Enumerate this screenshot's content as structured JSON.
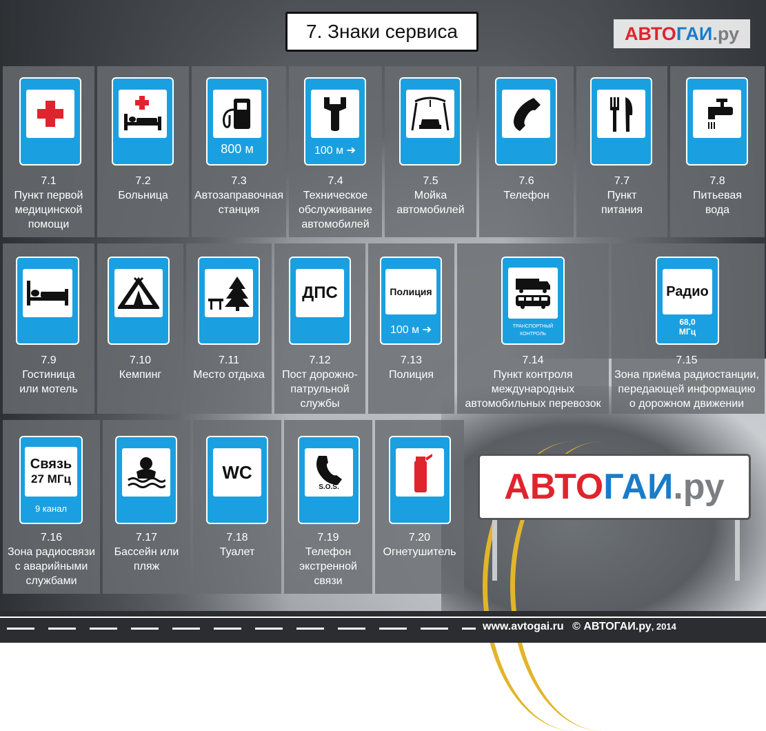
{
  "title": "7. Знаки сервиса",
  "brand": {
    "part1": "АВТО",
    "part2": "ГАИ",
    "part3": ".ру"
  },
  "big_brand": {
    "part1": "АВТО",
    "part2": "ГАИ",
    "part3": ".ру"
  },
  "footer": {
    "site": "www.avtogai.ru",
    "copyright": "© АВТОГАИ.ру",
    "year": ", 2014"
  },
  "colors": {
    "sign_blue": "#1aa0e0",
    "red": "#e0242e",
    "brand_blue": "#1a7cc9"
  },
  "signs": [
    {
      "num": "7.1",
      "lines": [
        "Пункт первой",
        "медицинской",
        "помощи"
      ],
      "icon": "first-aid-cross-icon"
    },
    {
      "num": "7.2",
      "lines": [
        "Больница"
      ],
      "icon": "hospital-bed-icon"
    },
    {
      "num": "7.3",
      "lines": [
        "Автозаправочная",
        "станция"
      ],
      "icon": "fuel-pump-icon",
      "sub": "800 м"
    },
    {
      "num": "7.4",
      "lines": [
        "Техническое",
        "обслуживание",
        "автомобилей"
      ],
      "icon": "wrench-icon",
      "sub": "100 м"
    },
    {
      "num": "7.5",
      "lines": [
        "Мойка",
        "автомобилей"
      ],
      "icon": "car-wash-icon"
    },
    {
      "num": "7.6",
      "lines": [
        "Телефон"
      ],
      "icon": "telephone-icon"
    },
    {
      "num": "7.7",
      "lines": [
        "Пункт",
        "питания"
      ],
      "icon": "fork-knife-icon"
    },
    {
      "num": "7.8",
      "lines": [
        "Питьевая",
        "вода"
      ],
      "icon": "water-tap-icon"
    },
    {
      "num": "7.9",
      "lines": [
        "Гостиница",
        "или мотель"
      ],
      "icon": "bed-icon"
    },
    {
      "num": "7.10",
      "lines": [
        "Кемпинг"
      ],
      "icon": "tent-icon"
    },
    {
      "num": "7.11",
      "lines": [
        "Место отдыха"
      ],
      "icon": "tree-bench-icon"
    },
    {
      "num": "7.12",
      "lines": [
        "Пост дорожно-",
        "патрульной",
        "службы"
      ],
      "icon": "dps-icon",
      "text": "ДПС"
    },
    {
      "num": "7.13",
      "lines": [
        "Полиция"
      ],
      "icon": "police-icon",
      "text": "Полиция",
      "sub": "100 м"
    },
    {
      "num": "7.14",
      "lines": [
        "Пункт контроля",
        "международных",
        "автомобильных перевозок"
      ],
      "icon": "truck-bus-icon",
      "text": "ТРАНСПОРТНЫЙ КОНТРОЛЬ"
    },
    {
      "num": "7.15",
      "lines": [
        "Зона приёма радиостанции,",
        "передающей информацию",
        "о дорожном движении"
      ],
      "icon": "radio-icon",
      "text": "Радио",
      "sub1": "68,0",
      "sub2": "МГц"
    },
    {
      "num": "7.16",
      "lines": [
        "Зона радиосвязи",
        "с аварийными",
        "службами"
      ],
      "icon": "radio-link-icon",
      "text1": "Связь",
      "text2": "27 МГц",
      "sub": "9 канал"
    },
    {
      "num": "7.17",
      "lines": [
        "Бассейн или",
        "пляж"
      ],
      "icon": "swimmer-icon"
    },
    {
      "num": "7.18",
      "lines": [
        "Туалет"
      ],
      "icon": "wc-icon",
      "text": "WC"
    },
    {
      "num": "7.19",
      "lines": [
        "Телефон",
        "экстренной",
        "связи"
      ],
      "icon": "sos-phone-icon",
      "text": "S.O.S."
    },
    {
      "num": "7.20",
      "lines": [
        "Огнетушитель"
      ],
      "icon": "fire-extinguisher-icon"
    }
  ]
}
